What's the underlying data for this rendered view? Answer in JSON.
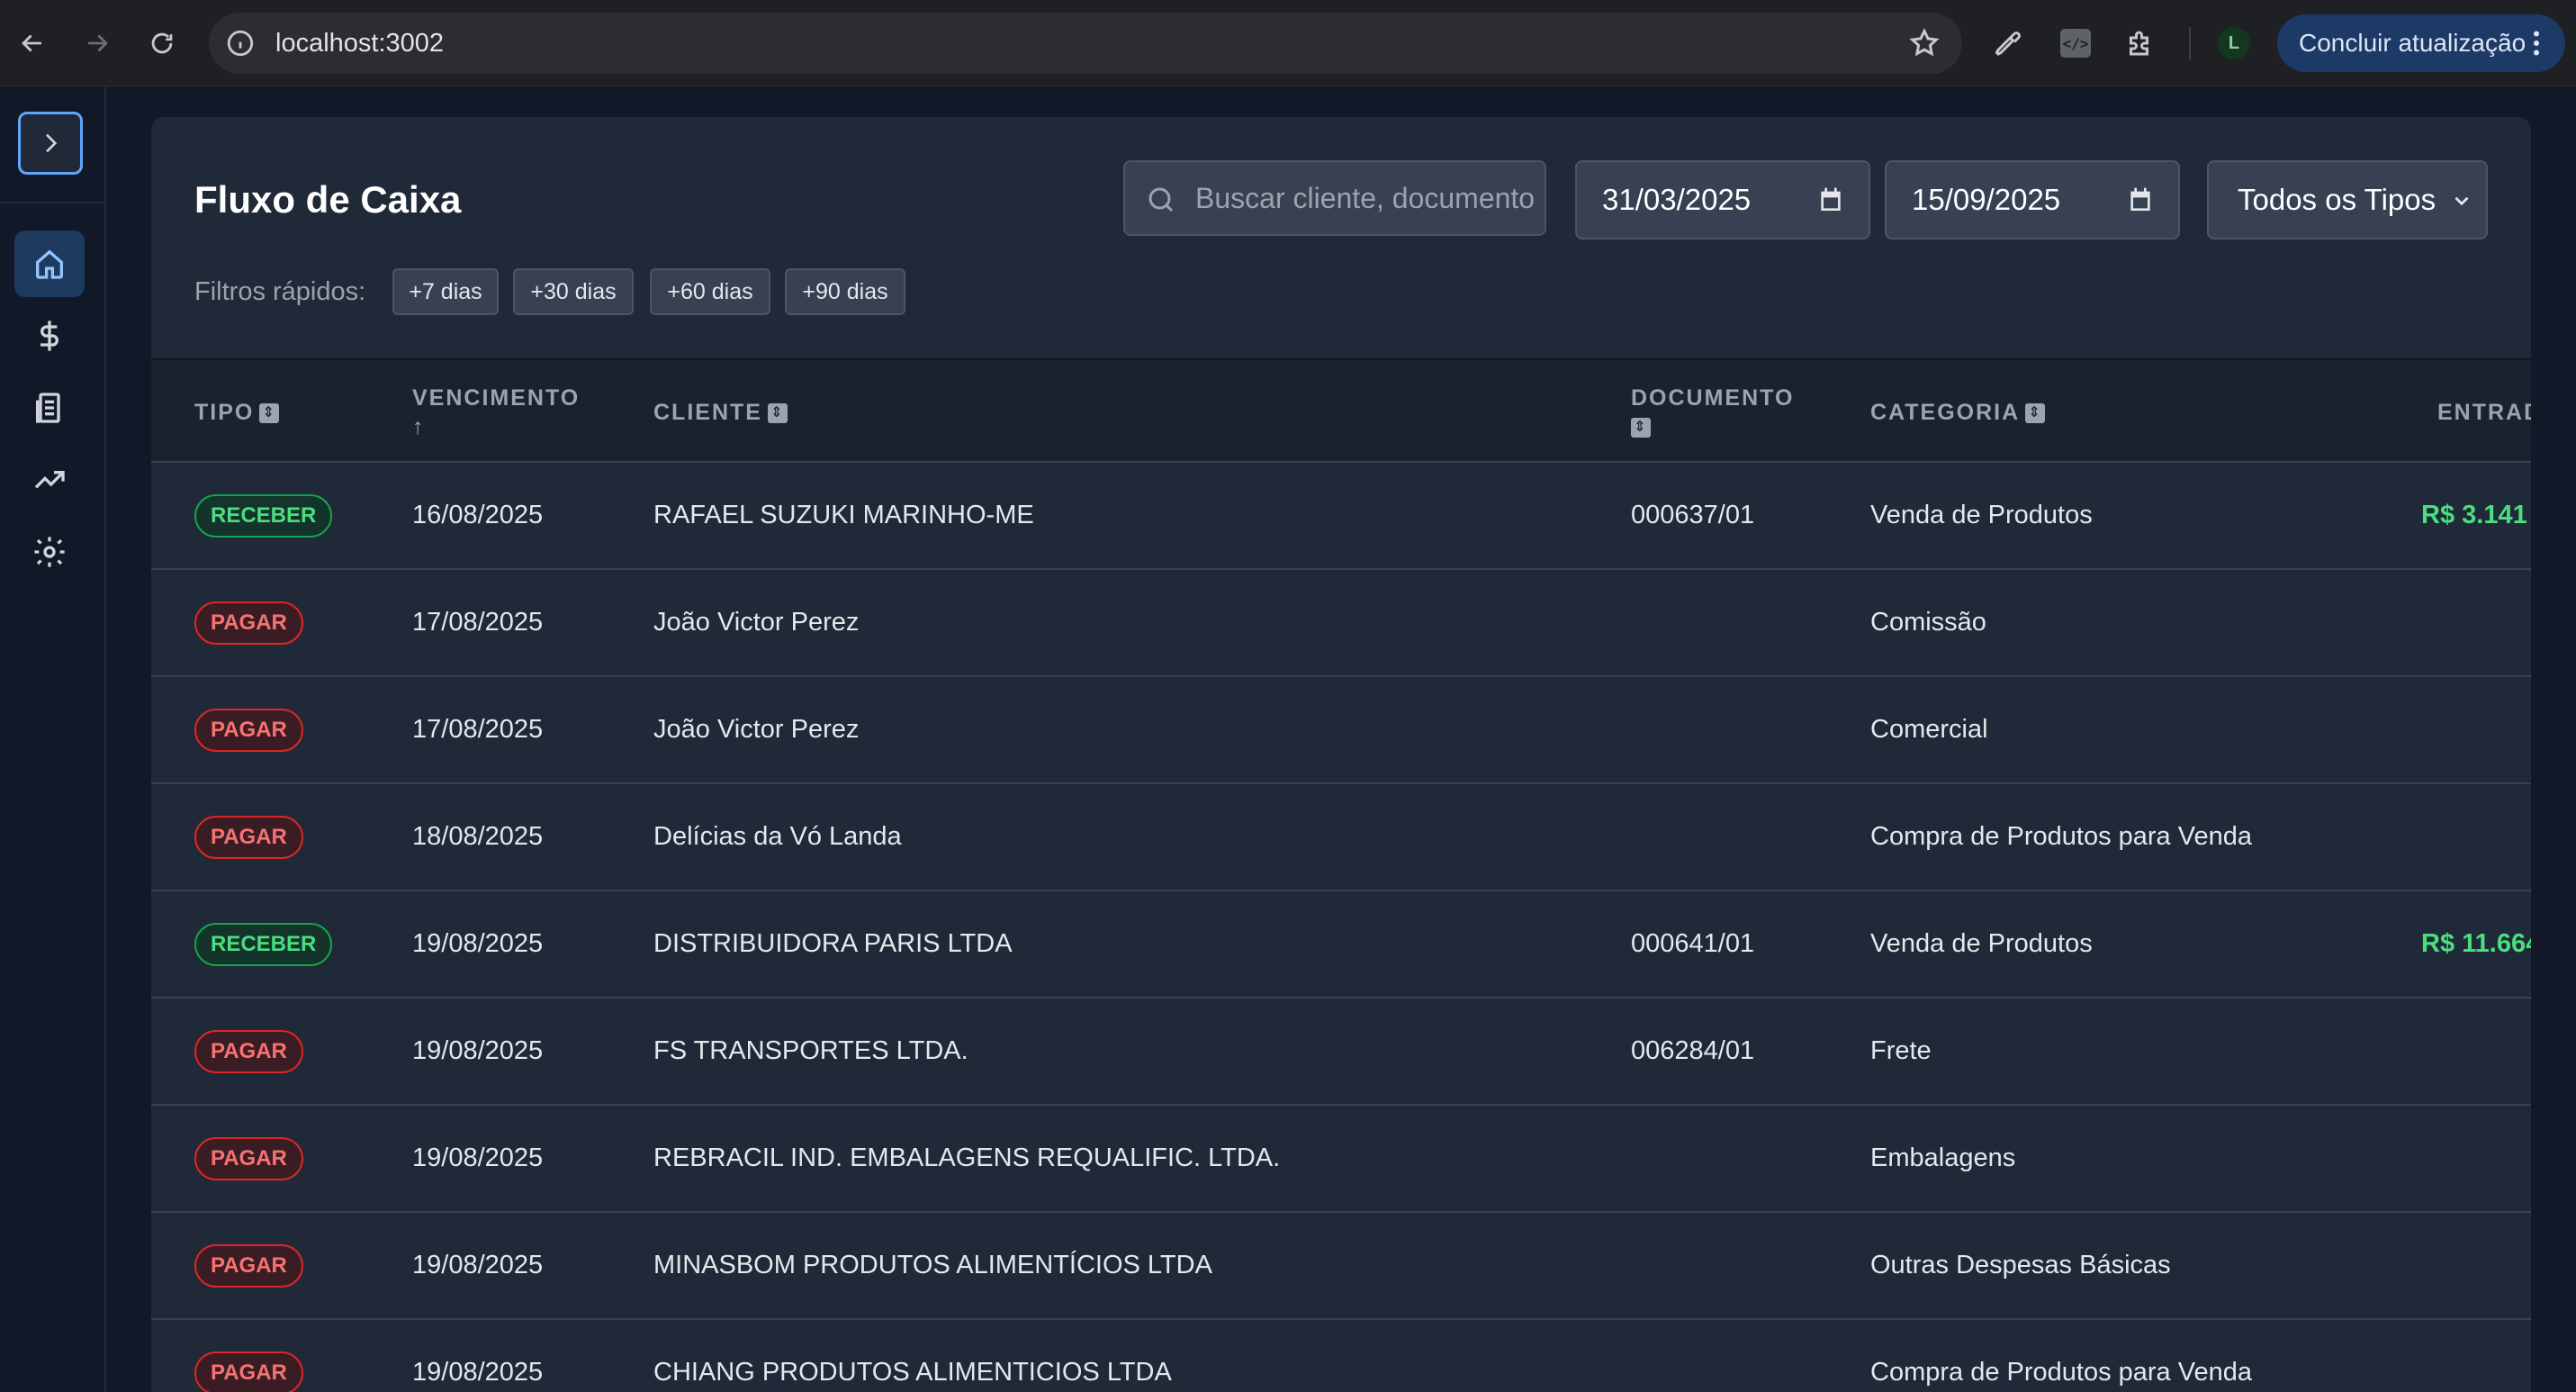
{
  "browser": {
    "url": "localhost:3002",
    "profile_initial": "L",
    "update_label": "Concluir atualização",
    "code_ext_label": "</>"
  },
  "sidebar": {
    "items": [
      {
        "name": "home",
        "icon": "home-icon",
        "active": true
      },
      {
        "name": "finance",
        "icon": "dollar-icon",
        "active": false
      },
      {
        "name": "reports",
        "icon": "document-icon",
        "active": false
      },
      {
        "name": "trends",
        "icon": "trending-up-icon",
        "active": false
      },
      {
        "name": "settings",
        "icon": "gear-icon",
        "active": false
      }
    ]
  },
  "page": {
    "title": "Fluxo de Caixa",
    "search_placeholder": "Buscar cliente, documento...",
    "date_from": "31/03/2025",
    "date_to": "15/09/2025",
    "type_filter": "Todos os Tipos",
    "quick_filters_label": "Filtros rápidos:",
    "quick_filters": [
      "+7 dias",
      "+30 dias",
      "+60 dias",
      "+90 dias"
    ]
  },
  "table": {
    "headers": {
      "tipo": "TIPO",
      "vencimento": "VENCIMENTO",
      "vencimento_sort": "↑",
      "cliente": "CLIENTE",
      "documento": "DOCUMENTO",
      "categoria": "CATEGORIA",
      "entrada": "ENTRADA"
    },
    "rows": [
      {
        "tipo": "RECEBER",
        "vencimento": "16/08/2025",
        "cliente": "RAFAEL SUZUKI MARINHO-ME",
        "documento": "000637/01",
        "categoria": "Venda de Produtos",
        "entrada": "R$ 3.141"
      },
      {
        "tipo": "PAGAR",
        "vencimento": "17/08/2025",
        "cliente": "João Victor Perez",
        "documento": "",
        "categoria": "Comissão",
        "entrada": ""
      },
      {
        "tipo": "PAGAR",
        "vencimento": "17/08/2025",
        "cliente": "João Victor Perez",
        "documento": "",
        "categoria": "Comercial",
        "entrada": ""
      },
      {
        "tipo": "PAGAR",
        "vencimento": "18/08/2025",
        "cliente": "Delícias da Vó Landa",
        "documento": "",
        "categoria": "Compra de Produtos para Venda",
        "entrada": ""
      },
      {
        "tipo": "RECEBER",
        "vencimento": "19/08/2025",
        "cliente": "DISTRIBUIDORA PARIS LTDA",
        "documento": "000641/01",
        "categoria": "Venda de Produtos",
        "entrada": "R$ 11.664"
      },
      {
        "tipo": "PAGAR",
        "vencimento": "19/08/2025",
        "cliente": "FS TRANSPORTES LTDA.",
        "documento": "006284/01",
        "categoria": "Frete",
        "entrada": ""
      },
      {
        "tipo": "PAGAR",
        "vencimento": "19/08/2025",
        "cliente": "REBRACIL IND. EMBALAGENS REQUALIFIC. LTDA.",
        "documento": "",
        "categoria": "Embalagens",
        "entrada": ""
      },
      {
        "tipo": "PAGAR",
        "vencimento": "19/08/2025",
        "cliente": "MINASBOM PRODUTOS ALIMENTÍCIOS LTDA",
        "documento": "",
        "categoria": "Outras Despesas Básicas",
        "entrada": ""
      },
      {
        "tipo": "PAGAR",
        "vencimento": "19/08/2025",
        "cliente": "CHIANG PRODUTOS ALIMENTICIOS LTDA",
        "documento": "",
        "categoria": "Compra de Produtos para Venda",
        "entrada": ""
      }
    ]
  },
  "colors": {
    "receber": "#4ade80",
    "pagar": "#f87171",
    "accent": "#60a5fa"
  }
}
